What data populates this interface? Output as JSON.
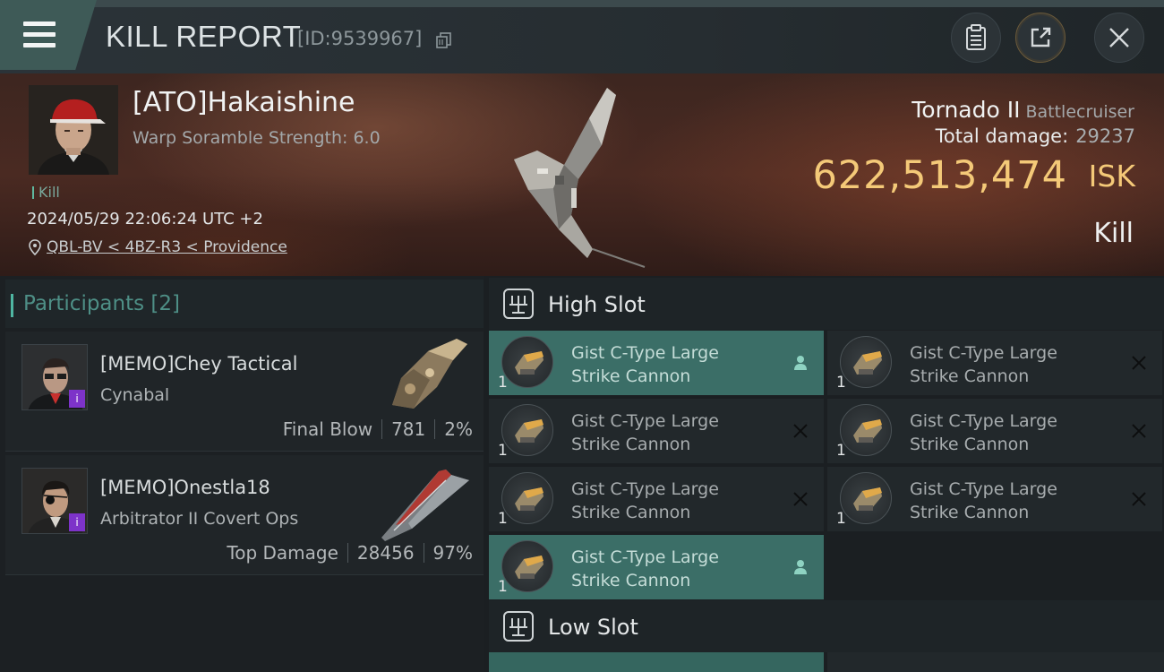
{
  "header": {
    "title": "KILL REPORT",
    "report_id": "[ID:9539967]"
  },
  "victim": {
    "name": "[ATO]Hakaishine",
    "scramble": "Warp Soramble Strength: 6.0",
    "tag": "Kill",
    "timestamp": "2024/05/29 22:06:24 UTC +2",
    "location": "QBL-BV < 4BZ-R3 < Providence",
    "ship_name": "Tornado II",
    "ship_class": "Battlecruiser",
    "total_damage_label": "Total damage:",
    "total_damage": "29237",
    "isk_value": "622,513,474",
    "isk_unit": "ISK",
    "result": "Kill"
  },
  "participants": {
    "title": "Participants [2]",
    "items": [
      {
        "name": "[MEMO]Chey Tactical",
        "ship": "Cynabal",
        "role": "Final Blow",
        "damage": "781",
        "percent": "2%"
      },
      {
        "name": "[MEMO]Onestla18",
        "ship": "Arbitrator II Covert Ops",
        "role": "Top Damage",
        "damage": "28456",
        "percent": "97%"
      }
    ]
  },
  "slots": {
    "high_title": "High Slot",
    "low_title": "Low Slot",
    "high": [
      {
        "line1": "Gist C-Type Large",
        "line2": "Strike Cannon",
        "qty": "1",
        "state": "active"
      },
      {
        "line1": "Gist C-Type Large",
        "line2": "Strike Cannon",
        "qty": "1",
        "state": "destroyed"
      },
      {
        "line1": "Gist C-Type Large",
        "line2": "Strike Cannon",
        "qty": "1",
        "state": "destroyed"
      },
      {
        "line1": "Gist C-Type Large",
        "line2": "Strike Cannon",
        "qty": "1",
        "state": "destroyed"
      },
      {
        "line1": "Gist C-Type Large",
        "line2": "Strike Cannon",
        "qty": "1",
        "state": "destroyed"
      },
      {
        "line1": "Gist C-Type Large",
        "line2": "Strike Cannon",
        "qty": "1",
        "state": "destroyed"
      },
      {
        "line1": "Gist C-Type Large",
        "line2": "Strike Cannon",
        "qty": "1",
        "state": "active"
      }
    ]
  },
  "colors": {
    "accent_teal": "#3b6e67",
    "isk_gold": "#f4c978",
    "badge_purple": "#7d33c9"
  }
}
